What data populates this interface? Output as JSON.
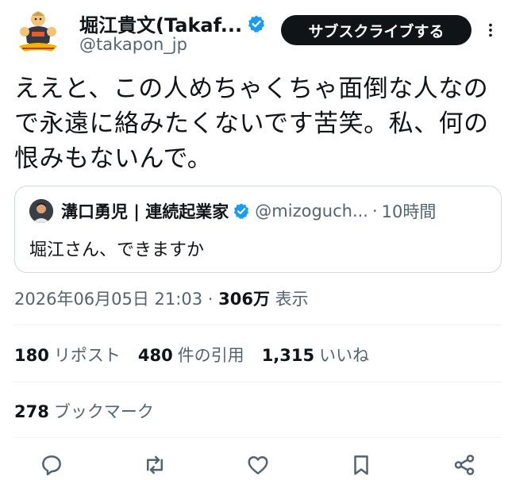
{
  "author": {
    "name": "堀江貴文(Takaf...",
    "handle": "@takapon_jp",
    "avatar_icon": "character-avatar-icon",
    "verified_color": "#1d9bf0"
  },
  "subscribe_label": "サブスクライブする",
  "tweet_text": "ええと、この人めちゃくちゃ面倒な人なので永遠に絡みたくないです苦笑。私、何の恨みもないんで。",
  "quote": {
    "name": "溝口勇児 | 連続起業家",
    "handle": "@mizoguch...",
    "separator": "·",
    "time": "10時間",
    "text": "堀江さん、できますか"
  },
  "meta": {
    "timestamp": "2026年06月05日 21:03",
    "separator": " · ",
    "views": "306万",
    "views_label": " 表示"
  },
  "stats": {
    "reposts": "180",
    "reposts_label": "リポスト",
    "quotes": "480",
    "quotes_label": "件の引用",
    "likes": "1,315",
    "likes_label": "いいね"
  },
  "bookmarks": {
    "count": "278",
    "label": "ブックマーク"
  },
  "actions": [
    "reply-icon",
    "repost-icon",
    "like-icon",
    "bookmark-icon",
    "share-icon"
  ]
}
